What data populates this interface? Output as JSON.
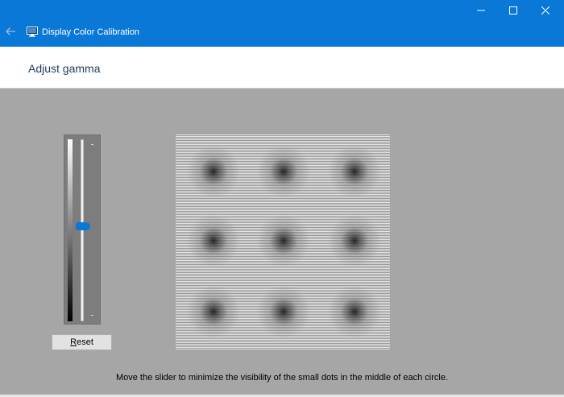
{
  "window": {
    "title": "Display Color Calibration",
    "accent_color": "#0a78d7",
    "icons": {
      "back": "back-arrow-icon",
      "app": "monitor-icon",
      "minimize": "minimize-icon",
      "maximize": "maximize-icon",
      "close": "close-icon"
    }
  },
  "header": {
    "heading": "Adjust gamma"
  },
  "gamma_slider": {
    "level": 0.52
  },
  "reset_button": {
    "label_underlined": "R",
    "label_rest": "eset"
  },
  "instruction": "Move the slider to minimize the visibility of the small dots in the middle of each circle."
}
